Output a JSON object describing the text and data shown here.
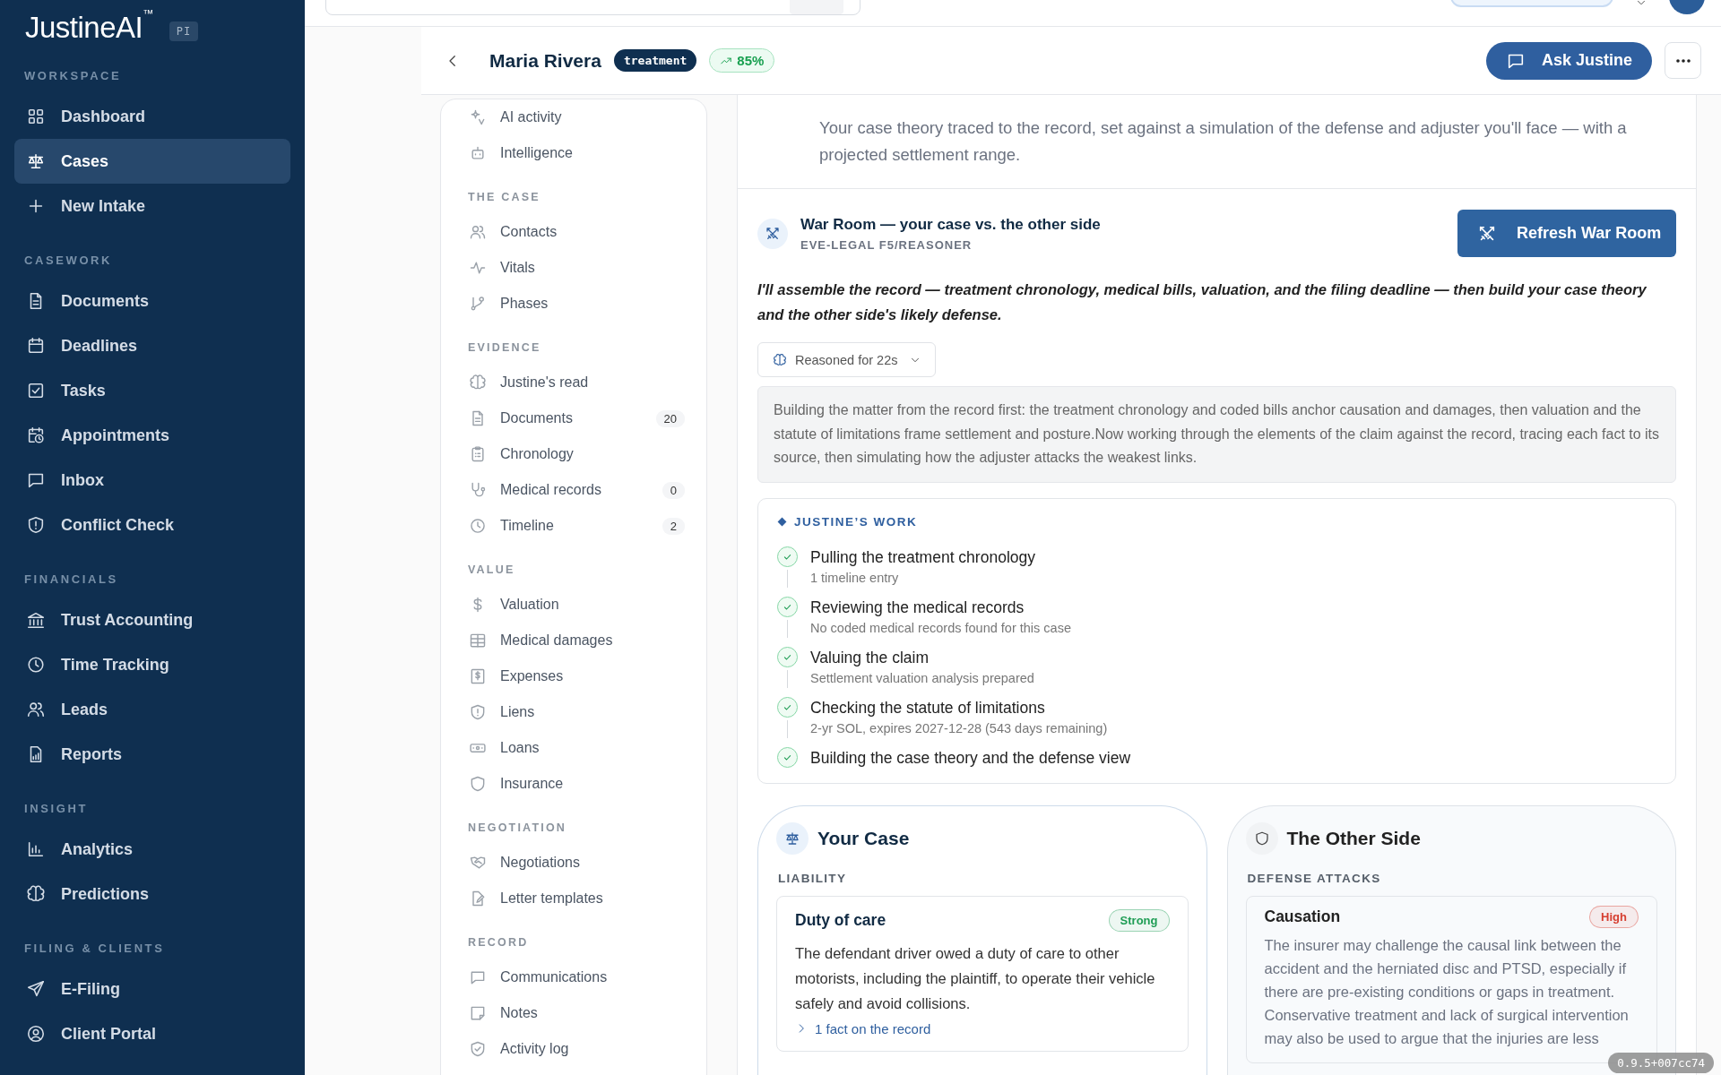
{
  "sidebar": {
    "logo": "JustineAI",
    "logo_mark": "™",
    "badge": "PI",
    "sections": [
      {
        "title": "WORKSPACE",
        "items": [
          {
            "label": "Dashboard",
            "selected": false
          },
          {
            "label": "Cases",
            "selected": true
          },
          {
            "label": "New Intake",
            "selected": false
          }
        ]
      },
      {
        "title": "CASEWORK",
        "items": [
          {
            "label": "Documents",
            "selected": false
          },
          {
            "label": "Deadlines",
            "selected": false
          },
          {
            "label": "Tasks",
            "selected": false
          },
          {
            "label": "Appointments",
            "selected": false
          },
          {
            "label": "Inbox",
            "selected": false
          },
          {
            "label": "Conflict Check",
            "selected": false
          }
        ]
      },
      {
        "title": "FINANCIALS",
        "items": [
          {
            "label": "Trust Accounting",
            "selected": false
          },
          {
            "label": "Time Tracking",
            "selected": false
          },
          {
            "label": "Leads",
            "selected": false
          },
          {
            "label": "Reports",
            "selected": false
          }
        ]
      },
      {
        "title": "INSIGHT",
        "items": [
          {
            "label": "Analytics",
            "selected": false
          },
          {
            "label": "Predictions",
            "selected": false
          }
        ]
      },
      {
        "title": "FILING & CLIENTS",
        "items": [
          {
            "label": "E-Filing",
            "selected": false
          },
          {
            "label": "Client Portal",
            "selected": false
          }
        ]
      }
    ]
  },
  "header": {
    "title": "Maria Rivera",
    "status": "treatment",
    "score": "85%",
    "ask_button": "Ask Justine"
  },
  "case_nav": {
    "sections": [
      {
        "items": [
          {
            "label": "AI activity"
          },
          {
            "label": "Intelligence"
          }
        ]
      },
      {
        "title": "THE CASE",
        "items": [
          {
            "label": "Contacts"
          },
          {
            "label": "Vitals"
          },
          {
            "label": "Phases"
          }
        ]
      },
      {
        "title": "EVIDENCE",
        "items": [
          {
            "label": "Justine's read"
          },
          {
            "label": "Documents",
            "count": "20"
          },
          {
            "label": "Chronology"
          },
          {
            "label": "Medical records",
            "count": "0"
          },
          {
            "label": "Timeline",
            "count": "2"
          }
        ]
      },
      {
        "title": "VALUE",
        "items": [
          {
            "label": "Valuation"
          },
          {
            "label": "Medical damages"
          },
          {
            "label": "Expenses"
          },
          {
            "label": "Liens"
          },
          {
            "label": "Loans"
          },
          {
            "label": "Insurance"
          }
        ]
      },
      {
        "title": "NEGOTIATION",
        "items": [
          {
            "label": "Negotiations"
          },
          {
            "label": "Letter templates"
          }
        ]
      },
      {
        "title": "RECORD",
        "items": [
          {
            "label": "Communications"
          },
          {
            "label": "Notes"
          },
          {
            "label": "Activity log"
          }
        ]
      }
    ]
  },
  "intro": {
    "text": "Your case theory traced to the record, set against a simulation of the defense and adjuster you'll face — with a projected settlement range."
  },
  "war_room": {
    "title": "War Room — your case vs. the other side",
    "subtitle": "EVE-LEGAL F5/REASONER",
    "button": "Refresh War Room",
    "plan": "I'll assemble the record — treatment chronology, medical bills, valuation, and the filing deadline — then build your case theory and the other side's likely defense.",
    "reasoning_toggle": {
      "label": "Reasoned for 22s",
      "expanded": true
    },
    "reasoning": "Building the matter from the record first: the treatment chronology and coded bills anchor causation and damages, then valuation and the statute of limitations frame settlement and posture.Now working through the elements of the claim against the record, tracing each fact to its source, then simulating how the adjuster attacks the weakest links.",
    "work": {
      "title": "JUSTINE’S WORK",
      "steps": [
        {
          "title": "Pulling the treatment chronology",
          "detail": "1 timeline entry",
          "done": true
        },
        {
          "title": "Reviewing the medical records",
          "detail": "No coded medical records found for this case",
          "done": true
        },
        {
          "title": "Valuing the claim",
          "detail": "Settlement valuation analysis prepared",
          "done": true
        },
        {
          "title": "Checking the statute of limitations",
          "detail": "2-yr SOL, expires 2027-12-28 (543 days remaining)",
          "done": true
        },
        {
          "title": "Building the case theory and the defense view",
          "done": true
        }
      ]
    }
  },
  "columns": [
    {
      "kind": "ours",
      "title": "Your Case",
      "section": "LIABILITY",
      "items": [
        {
          "title": "Duty of care",
          "badge": "Strong",
          "color": "#1f9d55",
          "text": "The defendant driver owed a duty of care to other motorists, including the plaintiff, to operate their vehicle safely and avoid collisions.",
          "facts": "1 fact on the record"
        }
      ]
    },
    {
      "kind": "theirs",
      "title": "The Other Side",
      "section": "DEFENSE ATTACKS",
      "items": [
        {
          "title": "Causation",
          "badge": "High",
          "color": "#d63f31",
          "text": "The insurer may challenge the causal link between the accident and the herniated disc and PTSD, especially if there are pre-existing conditions or gaps in treatment. Conservative treatment and lack of surgical intervention may also be used to argue that the injuries are less"
        }
      ]
    }
  ],
  "version": "0.9.5+007cc74"
}
